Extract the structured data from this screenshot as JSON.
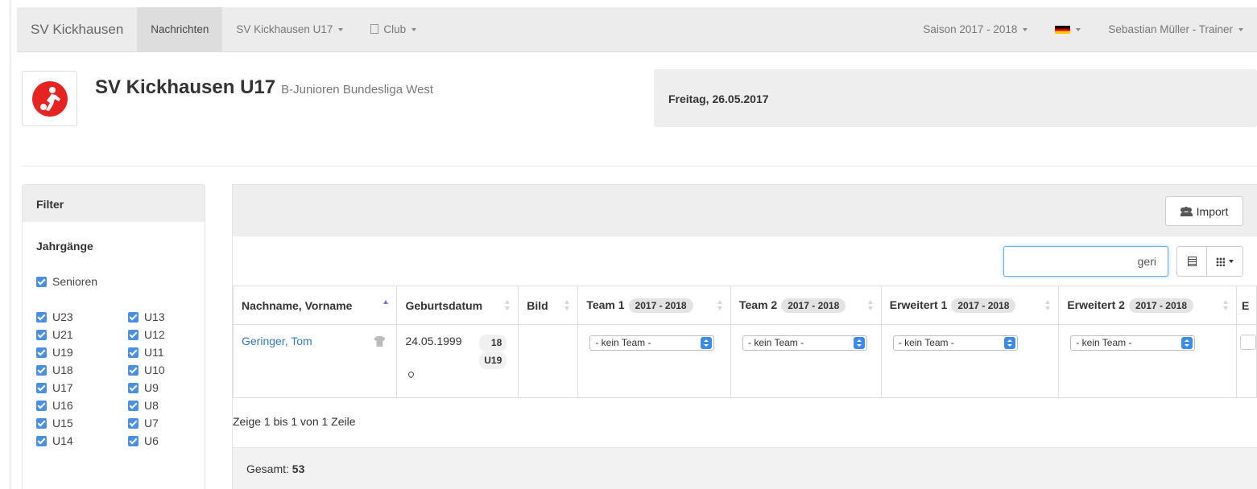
{
  "navbar": {
    "brand": "SV Kickhausen",
    "items": [
      {
        "label": "Nachrichten"
      },
      {
        "label": "SV Kickhausen U17"
      },
      {
        "label": "Club"
      }
    ],
    "season": "Saison 2017 - 2018",
    "language_flag": "de-flag-icon",
    "user": "Sebastian Müller - Trainer"
  },
  "header": {
    "team_name": "SV Kickhausen U17",
    "league": "B-Junioren Bundesliga West",
    "date": "Freitag, 26.05.2017",
    "logo": "club-logo-icon"
  },
  "filter": {
    "title": "Filter",
    "section": "Jahrgänge",
    "seniors": "Senioren",
    "col1": [
      "U23",
      "U21",
      "U19",
      "U18",
      "U17",
      "U16",
      "U15",
      "U14"
    ],
    "col2": [
      "U13",
      "U12",
      "U11",
      "U10",
      "U9",
      "U8",
      "U7",
      "U6"
    ]
  },
  "toolbar": {
    "import_label": "Import",
    "search_value": "geri"
  },
  "table": {
    "headers": {
      "name": "Nachname, Vorname",
      "birthdate": "Geburtsdatum",
      "image": "Bild",
      "team1": "Team 1",
      "team2": "Team 2",
      "ext1": "Erweitert 1",
      "ext2": "Erweitert 2",
      "ext3": "E",
      "season_badge": "2017 - 2018"
    },
    "rows": [
      {
        "name": "Geringer, Tom",
        "birthdate": "24.05.1999",
        "age": "18",
        "age_group": "U19",
        "team1": "- kein Team -",
        "team2": "- kein Team -",
        "ext1": "- kein Team -",
        "ext2": "- kein Team -"
      }
    ]
  },
  "pagination": {
    "info": "Zeige 1 bis 1 von 1 Zeile"
  },
  "footer": {
    "total_label": "Gesamt:",
    "total_value": "53"
  },
  "colors": {
    "accent": "#4a90e2",
    "link": "#337ab7",
    "logo_red": "#e52421"
  }
}
